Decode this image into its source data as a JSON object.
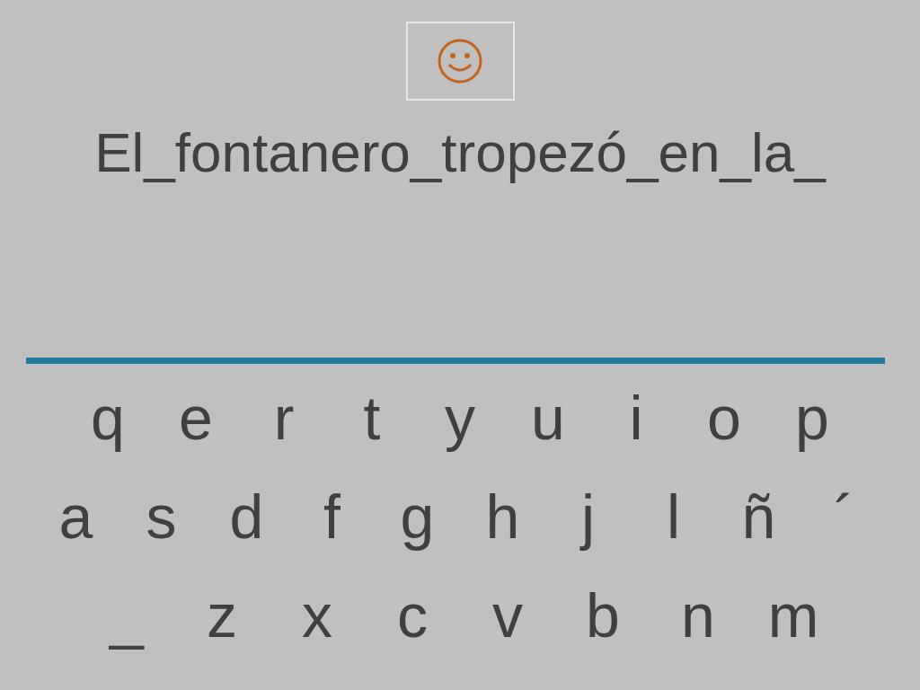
{
  "sentence": "El_fontanero_tropezó_en_la_",
  "keyboard": [
    {
      "keys": [
        "q",
        "e",
        "r",
        "t",
        "y",
        "u",
        "i",
        "o",
        "p"
      ]
    },
    {
      "keys": [
        "a",
        "s",
        "d",
        "f",
        "g",
        "h",
        "j",
        "l",
        "ñ",
        "´"
      ]
    },
    {
      "keys": [
        "_",
        "z",
        "x",
        "c",
        "v",
        "b",
        "n",
        "m"
      ]
    }
  ]
}
